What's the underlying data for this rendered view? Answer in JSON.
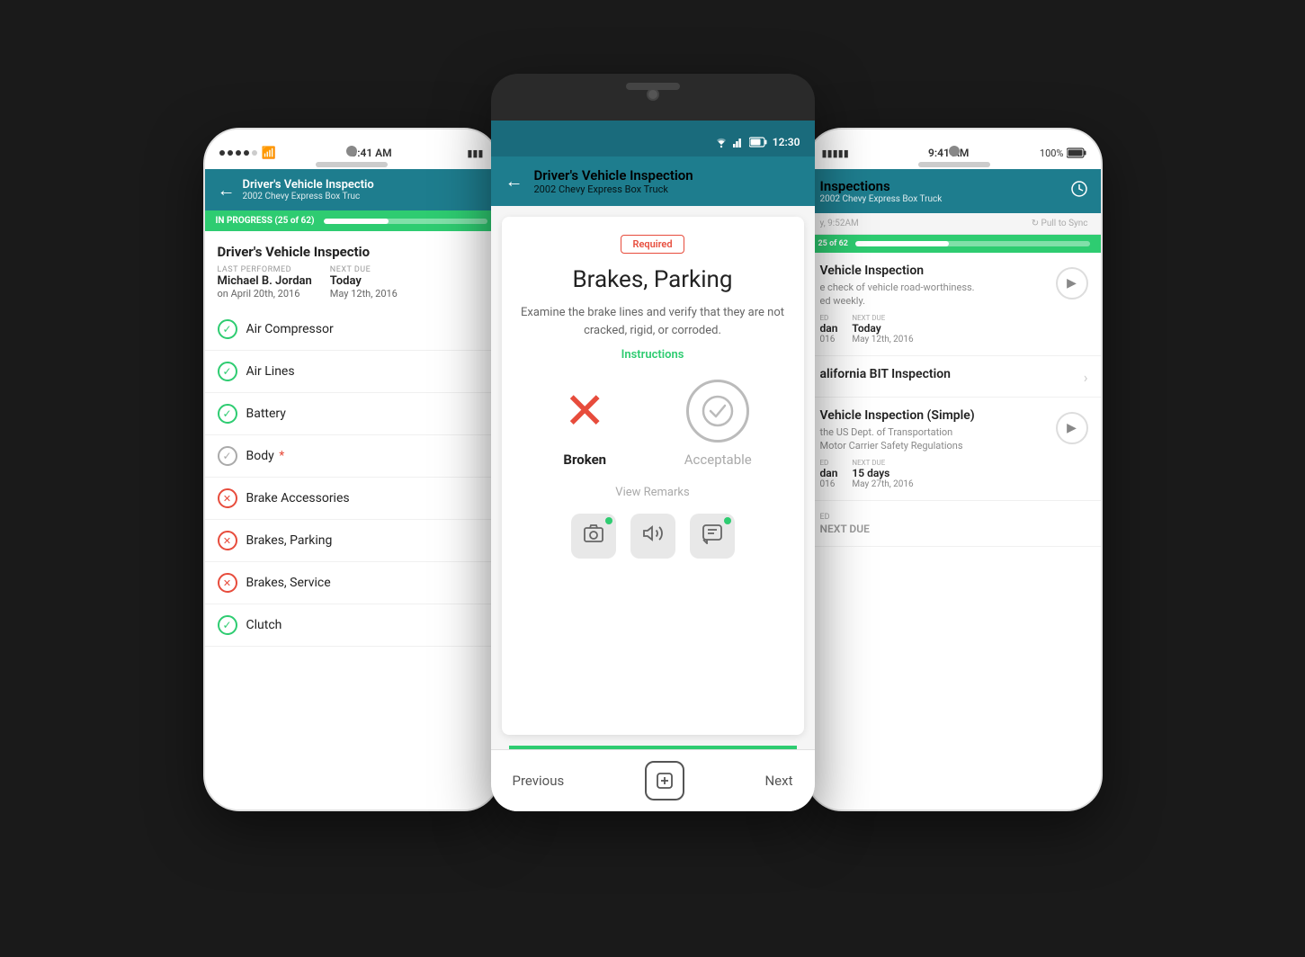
{
  "scene": {
    "bg_color": "#1a1a1a"
  },
  "left_phone": {
    "status_bar": {
      "dots": 5,
      "wifi": "wifi",
      "time": "9:41 AM"
    },
    "header": {
      "back_icon": "←",
      "title": "Driver's Vehicle Inspectio",
      "subtitle": "2002 Chevy Express Box Truc"
    },
    "progress": {
      "label": "IN PROGRESS (25 of 62)",
      "percent": 40
    },
    "inspection_title": "Driver's Vehicle Inspectio",
    "last_performed_label": "LAST PERFORMED",
    "last_performed_name": "Michael B. Jordan",
    "last_performed_date": "on April 20th, 2016",
    "next_due_label": "NEXT DUE",
    "next_due_val": "Today",
    "next_due_date": "May 12th, 2016",
    "items": [
      {
        "label": "Air Compressor",
        "status": "green_check"
      },
      {
        "label": "Air Lines",
        "status": "green_check"
      },
      {
        "label": "Battery",
        "status": "green_check"
      },
      {
        "label": "Body",
        "status": "gray_check",
        "required": true
      },
      {
        "label": "Brake Accessories",
        "status": "red_x"
      },
      {
        "label": "Brakes, Parking",
        "status": "red_x"
      },
      {
        "label": "Brakes, Service",
        "status": "red_x"
      },
      {
        "label": "Clutch",
        "status": "green_check"
      }
    ]
  },
  "center_phone": {
    "android_status": {
      "signal_icon": "▾",
      "bars_icon": "▌▌",
      "battery_icon": "🔋",
      "time": "12:30"
    },
    "header": {
      "back_icon": "←",
      "title": "Driver's Vehicle Inspection",
      "subtitle": "2002 Chevy Express Box Truck"
    },
    "modal": {
      "required_badge": "Required",
      "item_title": "Brakes, Parking",
      "description": "Examine the brake lines and verify that they are not cracked, rigid, or corroded.",
      "instructions_link": "Instructions",
      "broken_label": "Broken",
      "acceptable_label": "Acceptable",
      "view_remarks": "View Remarks"
    },
    "bottom_nav": {
      "previous": "Previous",
      "next": "Next"
    },
    "teal_line_color": "#2ecc71"
  },
  "right_phone": {
    "status_bar": {
      "time": "9:41 AM",
      "battery": "100%"
    },
    "header": {
      "title": "Inspections",
      "subtitle": "2002 Chevy Express Box Truck",
      "history_icon": "🕐"
    },
    "sync_bar": {
      "left_text": "y, 9:52AM",
      "right_text": "↻  Pull to Sync"
    },
    "progress": {
      "label": "25 of 62",
      "percent": 40
    },
    "inspections": [
      {
        "title": "Vehicle Inspection",
        "desc": "e check of vehicle road-worthiness.\ned weekly.",
        "last_performed_label": "ED",
        "last_performed_val": "dan",
        "last_performed_date": "016",
        "next_due_label": "NEXT DUE",
        "next_due_val": "Today",
        "next_due_date": "May 12th, 2016",
        "type": "play"
      },
      {
        "title": "alifornia BIT Inspection",
        "type": "chevron"
      },
      {
        "title": "Vehicle Inspection (Simple)",
        "desc": "the US Dept. of Transportation\nMotor Carrier Safety Regulations",
        "last_performed_label": "ED",
        "last_performed_val": "dan",
        "last_performed_date": "016",
        "next_due_label": "NEXT DUE",
        "next_due_val": "15 days",
        "next_due_date": "May 27th, 2016",
        "type": "play"
      }
    ]
  }
}
